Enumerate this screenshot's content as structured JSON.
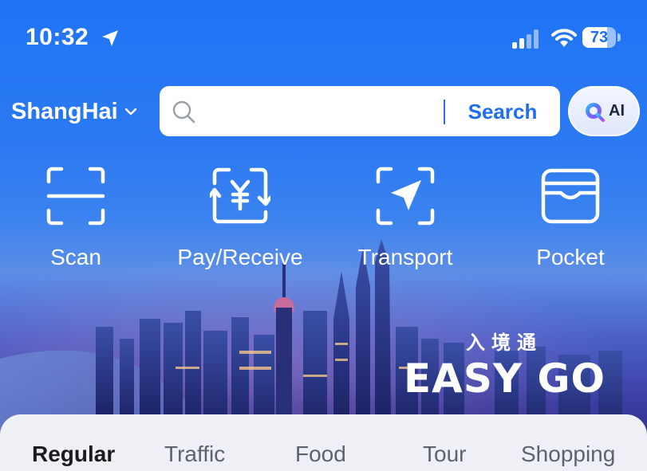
{
  "status_bar": {
    "time": "10:32",
    "battery_percent": 73,
    "battery_label": "73",
    "icons": [
      "location-arrow-icon",
      "signal-icon",
      "wifi-icon",
      "battery-icon"
    ]
  },
  "header": {
    "city": "ShangHai",
    "search": {
      "placeholder": "",
      "value": "",
      "button_label": "Search"
    },
    "ai_button_label": "AI"
  },
  "quick_actions": [
    {
      "label": "Scan",
      "icon": "scan-icon"
    },
    {
      "label": "Pay/Receive",
      "icon": "yuan-pay-icon"
    },
    {
      "label": "Transport",
      "icon": "navigation-arrow-icon"
    },
    {
      "label": "Pocket",
      "icon": "wallet-icon"
    }
  ],
  "banner": {
    "brand_cn": "入境通",
    "brand_en": "EASY GO"
  },
  "tabs": [
    {
      "label": "Regular",
      "active": true
    },
    {
      "label": "Traffic",
      "active": false
    },
    {
      "label": "Food",
      "active": false
    },
    {
      "label": "Tour",
      "active": false
    },
    {
      "label": "Shopping",
      "active": false
    }
  ],
  "colors": {
    "primary": "#1f74f4",
    "search_accent": "#1d6ef1",
    "tab_active": "#1a1c22",
    "tab_inactive": "#5d6270"
  }
}
